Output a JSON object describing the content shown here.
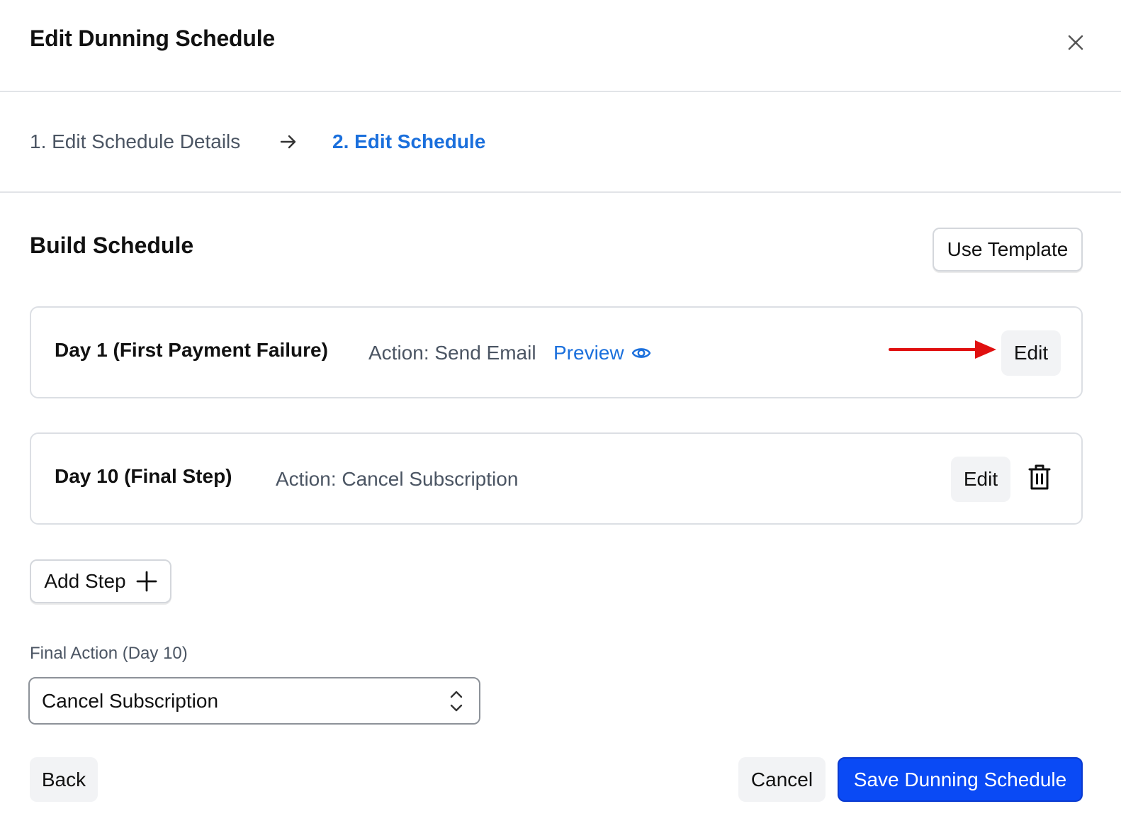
{
  "header": {
    "title": "Edit Dunning Schedule",
    "close_icon": "close-icon"
  },
  "stepper": {
    "steps": [
      {
        "label": "1. Edit Schedule Details",
        "state": "completed"
      },
      {
        "label": "2. Edit Schedule",
        "state": "active"
      }
    ],
    "separator_icon": "arrow-right-icon",
    "active_color": "#1a6fdc"
  },
  "build": {
    "title": "Build Schedule",
    "use_template_label": "Use Template",
    "steps": [
      {
        "day_label": "Day 1 (First Payment Failure)",
        "action": "Action: Send Email",
        "preview_label": "Preview",
        "preview_icon": "eye-icon",
        "edit_label": "Edit"
      },
      {
        "day_label": "Day 10 (Final Step)",
        "action": "Action: Cancel Subscription",
        "edit_label": "Edit",
        "delete_icon": "trash-icon"
      }
    ],
    "add_step_label": "Add Step",
    "add_step_icon": "plus-icon"
  },
  "annotation": {
    "icon": "red-arrow-icon",
    "color": "#e01010"
  },
  "final_action": {
    "label": "Final Action (Day 10)",
    "selected_value": "Cancel Subscription"
  },
  "footer": {
    "back_label": "Back",
    "cancel_label": "Cancel",
    "save_label": "Save Dunning Schedule",
    "save_color": "#0a4af5"
  }
}
